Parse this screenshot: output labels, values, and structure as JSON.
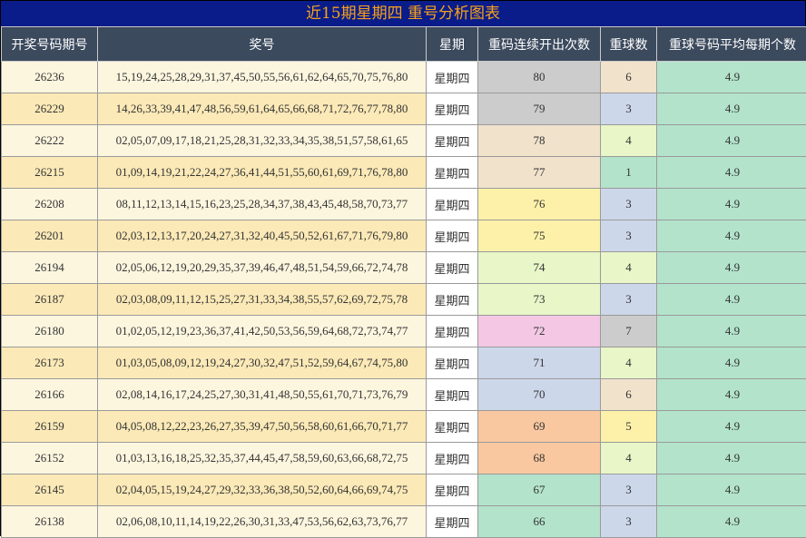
{
  "title": "近15期星期四 重号分析图表",
  "headers": [
    "开奖号码期号",
    "奖号",
    "星期",
    "重码连续开出次数",
    "重球数",
    "重球号码平均每期个数"
  ],
  "colors": {
    "title_bg": "#0a1c8a",
    "title_fg": "#f6a21b",
    "header_bg": "#3c4a5e",
    "row_light": "#fdf6df",
    "row_dark": "#fbe9b7",
    "gray": "#cccccc",
    "beige": "#f1e2cc",
    "yellow": "#fdf1a9",
    "lime": "#e8f6c8",
    "pink": "#f4c8e4",
    "blue": "#cdd7ea",
    "orange": "#f9c8a0",
    "mint": "#b3e3cb"
  },
  "rows": [
    {
      "issue": "26236",
      "numbers": "15,19,24,25,28,29,31,37,45,50,55,56,61,62,64,65,70,75,76,80",
      "day": "星期四",
      "run": "80",
      "run_color": "gray",
      "count": "6",
      "count_color": "beige",
      "avg": "4.9"
    },
    {
      "issue": "26229",
      "numbers": "14,26,33,39,41,47,48,56,59,61,64,65,66,68,71,72,76,77,78,80",
      "day": "星期四",
      "run": "79",
      "run_color": "gray",
      "count": "3",
      "count_color": "blue",
      "avg": "4.9"
    },
    {
      "issue": "26222",
      "numbers": "02,05,07,09,17,18,21,25,28,31,32,33,34,35,38,51,57,58,61,65",
      "day": "星期四",
      "run": "78",
      "run_color": "beige",
      "count": "4",
      "count_color": "lime",
      "avg": "4.9"
    },
    {
      "issue": "26215",
      "numbers": "01,09,14,19,21,22,24,27,36,41,44,51,55,60,61,69,71,76,78,80",
      "day": "星期四",
      "run": "77",
      "run_color": "beige",
      "count": "1",
      "count_color": "mint",
      "avg": "4.9"
    },
    {
      "issue": "26208",
      "numbers": "08,11,12,13,14,15,16,23,25,28,34,37,38,43,45,48,58,70,73,77",
      "day": "星期四",
      "run": "76",
      "run_color": "yellow",
      "count": "3",
      "count_color": "blue",
      "avg": "4.9"
    },
    {
      "issue": "26201",
      "numbers": "02,03,12,13,17,20,24,27,31,32,40,45,50,52,61,67,71,76,79,80",
      "day": "星期四",
      "run": "75",
      "run_color": "yellow",
      "count": "3",
      "count_color": "blue",
      "avg": "4.9"
    },
    {
      "issue": "26194",
      "numbers": "02,05,06,12,19,20,29,35,37,39,46,47,48,51,54,59,66,72,74,78",
      "day": "星期四",
      "run": "74",
      "run_color": "lime",
      "count": "4",
      "count_color": "lime",
      "avg": "4.9"
    },
    {
      "issue": "26187",
      "numbers": "02,03,08,09,11,12,15,25,27,31,33,34,38,55,57,62,69,72,75,78",
      "day": "星期四",
      "run": "73",
      "run_color": "lime",
      "count": "3",
      "count_color": "blue",
      "avg": "4.9"
    },
    {
      "issue": "26180",
      "numbers": "01,02,05,12,19,23,36,37,41,42,50,53,56,59,64,68,72,73,74,77",
      "day": "星期四",
      "run": "72",
      "run_color": "pink",
      "count": "7",
      "count_color": "gray",
      "avg": "4.9"
    },
    {
      "issue": "26173",
      "numbers": "01,03,05,08,09,12,19,24,27,30,32,47,51,52,59,64,67,74,75,80",
      "day": "星期四",
      "run": "71",
      "run_color": "blue",
      "count": "4",
      "count_color": "lime",
      "avg": "4.9"
    },
    {
      "issue": "26166",
      "numbers": "02,08,14,16,17,24,25,27,30,31,41,48,50,55,61,70,71,73,76,79",
      "day": "星期四",
      "run": "70",
      "run_color": "blue",
      "count": "6",
      "count_color": "beige",
      "avg": "4.9"
    },
    {
      "issue": "26159",
      "numbers": "04,05,08,12,22,23,26,27,35,39,47,50,56,58,60,61,66,70,71,77",
      "day": "星期四",
      "run": "69",
      "run_color": "orange",
      "count": "5",
      "count_color": "yellow",
      "avg": "4.9"
    },
    {
      "issue": "26152",
      "numbers": "01,03,13,16,18,25,32,35,37,44,45,47,58,59,60,63,66,68,72,75",
      "day": "星期四",
      "run": "68",
      "run_color": "orange",
      "count": "4",
      "count_color": "lime",
      "avg": "4.9"
    },
    {
      "issue": "26145",
      "numbers": "02,04,05,15,19,24,27,29,32,33,36,38,50,52,60,64,66,69,74,75",
      "day": "星期四",
      "run": "67",
      "run_color": "mint",
      "count": "3",
      "count_color": "blue",
      "avg": "4.9"
    },
    {
      "issue": "26138",
      "numbers": "02,06,08,10,11,14,19,22,26,30,31,33,47,53,56,62,63,73,76,77",
      "day": "星期四",
      "run": "66",
      "run_color": "mint",
      "count": "3",
      "count_color": "blue",
      "avg": "4.9"
    }
  ]
}
